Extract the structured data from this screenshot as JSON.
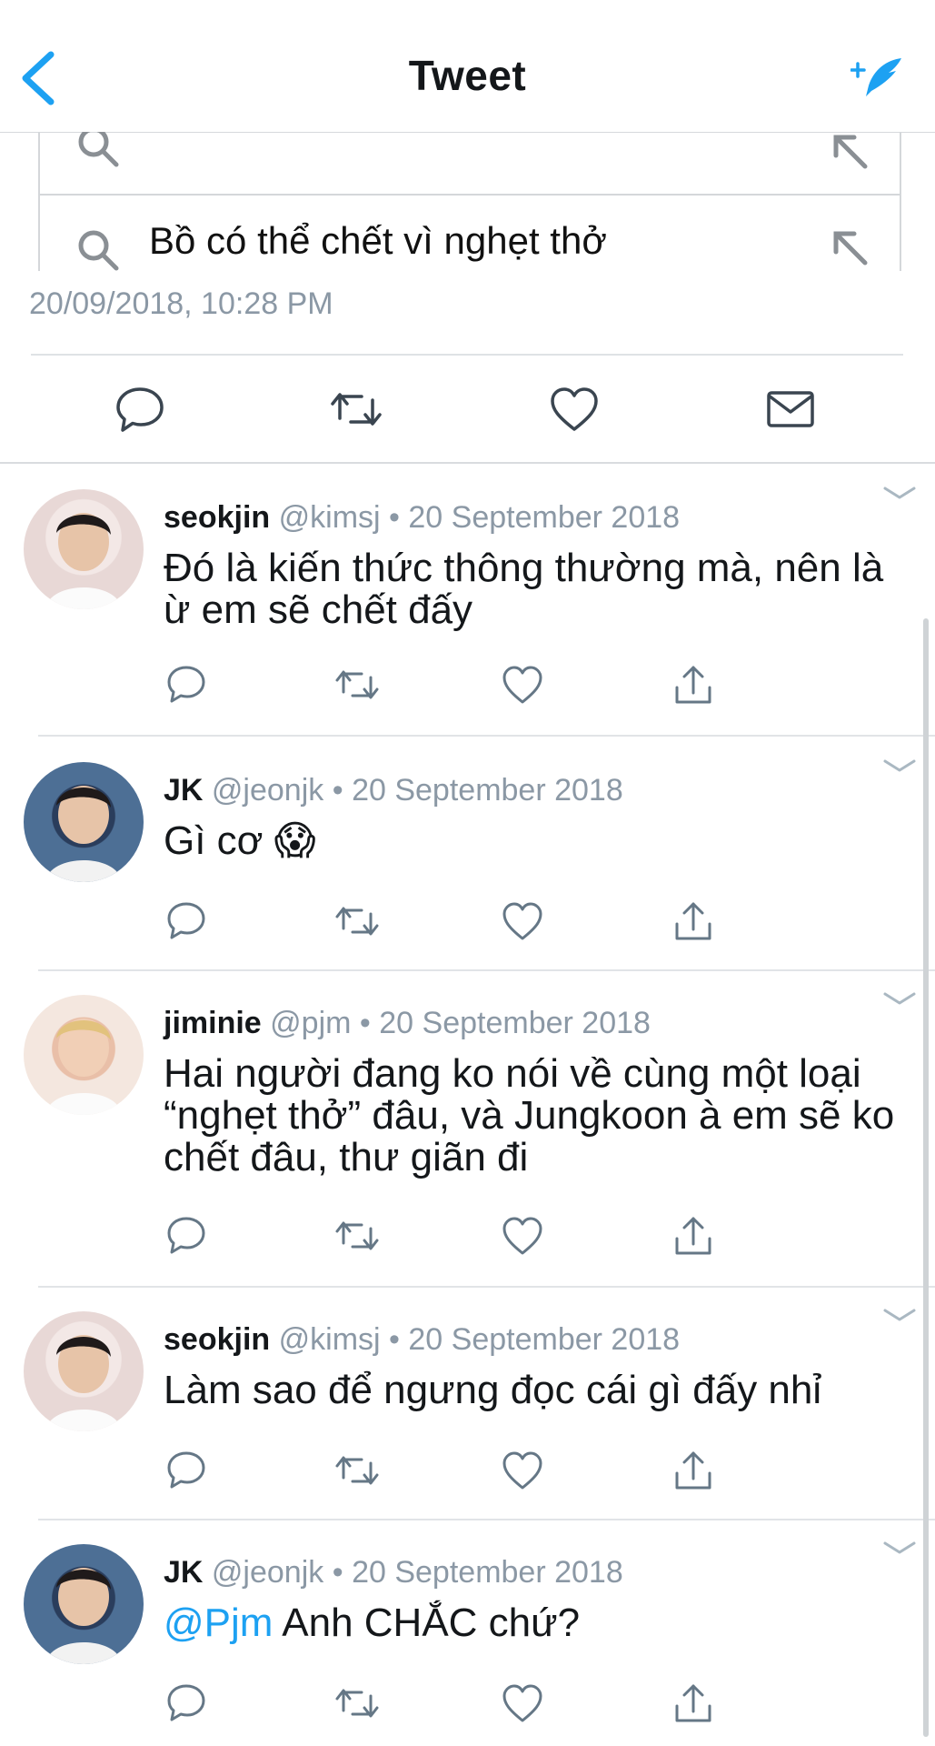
{
  "header": {
    "title": "Tweet",
    "back_icon": "chevron-left-icon",
    "compose_icon": "compose-feather-icon",
    "accent": "#1da1f2"
  },
  "embedded_search": {
    "suggestion": "Bồ có thể chết vì nghẹt thở"
  },
  "tweet": {
    "timestamp": "20/09/2018, 10:28 PM"
  },
  "replies": [
    {
      "name": "seokjin",
      "handle": "@kimsj",
      "date": "• 20 September 2018",
      "text": "Đó là kiến thức thông thường mà, nên là ừ em sẽ chết đấy",
      "mention": ""
    },
    {
      "name": "JK",
      "handle": "@jeonjk",
      "date": "• 20 September 2018",
      "text": "Gì cơ 😱",
      "mention": ""
    },
    {
      "name": "jiminie",
      "handle": "@pjm",
      "date": "• 20 September 2018",
      "text": "Hai người đang ko nói về cùng một loại “nghẹt thở” đâu, và Jungkoon à em sẽ ko chết đâu, thư giãn đi",
      "mention": ""
    },
    {
      "name": "seokjin",
      "handle": "@kimsj",
      "date": "• 20 September 2018",
      "text": "Làm sao để ngưng đọc cái gì đấy nhỉ",
      "mention": ""
    },
    {
      "name": "JK",
      "handle": "@jeonjk",
      "date": "• 20 September 2018",
      "text": "Anh CHẮC chứ?",
      "mention": "@Pjm"
    }
  ]
}
